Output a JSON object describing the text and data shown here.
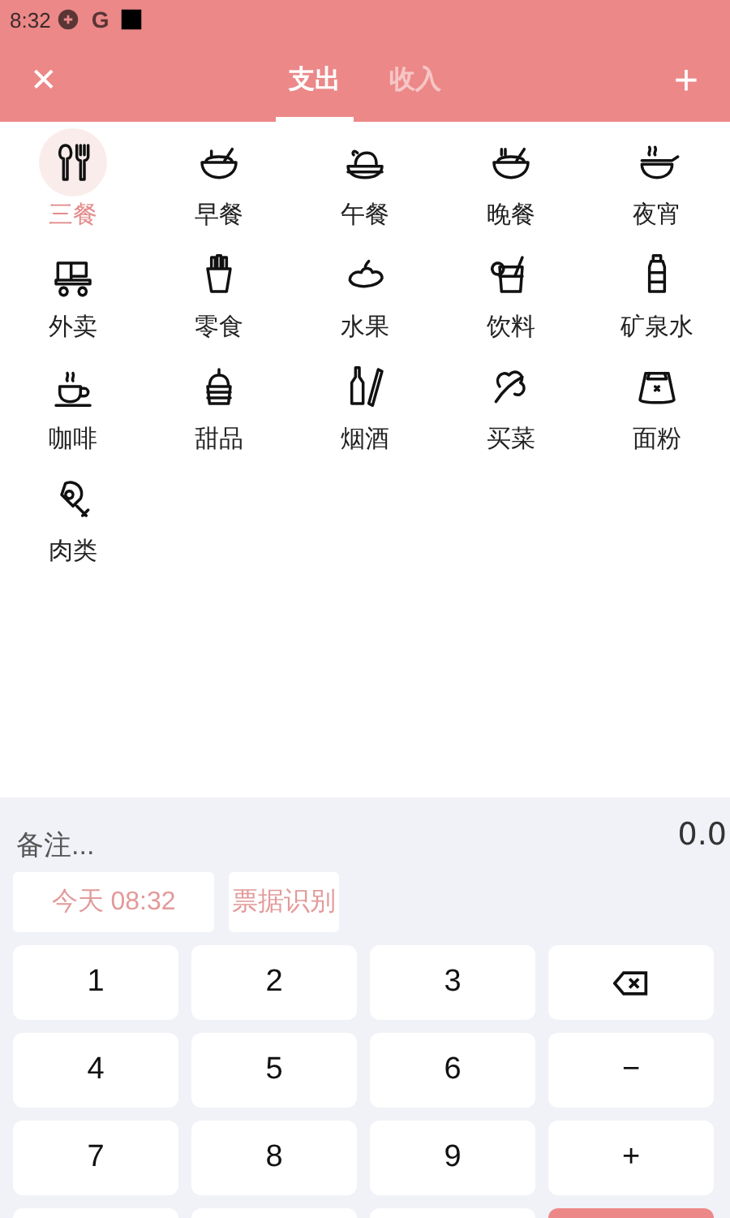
{
  "status_bar": {
    "time": "8:32",
    "app_letter": "G"
  },
  "header": {
    "close": "✕",
    "add": "+",
    "tabs": [
      {
        "label": "支出",
        "selected": true
      },
      {
        "label": "收入",
        "selected": false
      }
    ]
  },
  "categories": [
    {
      "label": "三餐",
      "selected": true
    },
    {
      "label": "早餐",
      "selected": false
    },
    {
      "label": "午餐",
      "selected": false
    },
    {
      "label": "晚餐",
      "selected": false
    },
    {
      "label": "夜宵",
      "selected": false
    },
    {
      "label": "外卖",
      "selected": false
    },
    {
      "label": "零食",
      "selected": false
    },
    {
      "label": "水果",
      "selected": false
    },
    {
      "label": "饮料",
      "selected": false
    },
    {
      "label": "矿泉水",
      "selected": false
    },
    {
      "label": "咖啡",
      "selected": false
    },
    {
      "label": "甜品",
      "selected": false
    },
    {
      "label": "烟酒",
      "selected": false
    },
    {
      "label": "买菜",
      "selected": false
    },
    {
      "label": "面粉",
      "selected": false
    },
    {
      "label": "肉类",
      "selected": false
    }
  ],
  "note": {
    "placeholder": "备注..."
  },
  "amount": "0.0",
  "date_button": "今天 08:32",
  "receipt_button": "票据识别",
  "keys": [
    {
      "kind": "digit",
      "label": "1"
    },
    {
      "kind": "digit",
      "label": "2"
    },
    {
      "kind": "digit",
      "label": "3"
    },
    {
      "kind": "backspace"
    },
    {
      "kind": "digit",
      "label": "4"
    },
    {
      "kind": "digit",
      "label": "5"
    },
    {
      "kind": "digit",
      "label": "6"
    },
    {
      "kind": "digit",
      "label": "−"
    },
    {
      "kind": "digit",
      "label": "7"
    },
    {
      "kind": "digit",
      "label": "8"
    },
    {
      "kind": "digit",
      "label": "9"
    },
    {
      "kind": "digit",
      "label": "+"
    },
    {
      "kind": "blank"
    },
    {
      "kind": "blank"
    },
    {
      "kind": "blank"
    },
    {
      "kind": "confirm"
    }
  ]
}
